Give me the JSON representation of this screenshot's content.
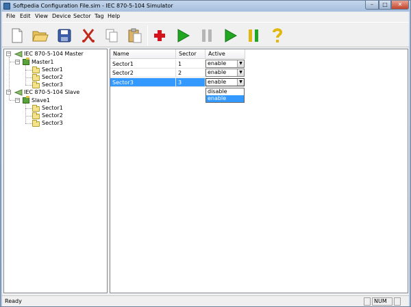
{
  "window": {
    "title": "Softpedia Configuration File.sim - IEC 870-5-104 Simulator"
  },
  "menu": [
    "File",
    "Edit",
    "View",
    "Device",
    "Sector",
    "Tag",
    "Help"
  ],
  "toolbar": {
    "buttons": [
      {
        "icon": "new-file-icon"
      },
      {
        "icon": "open-folder-icon"
      },
      {
        "icon": "save-icon"
      },
      {
        "icon": "cut-icon"
      },
      {
        "icon": "copy-icon"
      },
      {
        "icon": "paste-icon"
      },
      {
        "icon": "add-icon"
      },
      {
        "icon": "play-icon"
      },
      {
        "icon": "pause-icon"
      },
      {
        "icon": "play-all-icon"
      },
      {
        "icon": "step-icon"
      },
      {
        "icon": "help-icon"
      }
    ]
  },
  "tree": {
    "master_root": "IEC 870-5-104 Master",
    "master_device": "Master1",
    "master_sectors": [
      "Sector1",
      "Sector2",
      "Sector3"
    ],
    "slave_root": "IEC 870-5-104 Slave",
    "slave_device": "Slave1",
    "slave_sectors": [
      "Sector1",
      "Sector2",
      "Sector3"
    ]
  },
  "grid": {
    "headers": {
      "name": "Name",
      "sector": "Sector",
      "active": "Active"
    },
    "rows": [
      {
        "name": "Sector1",
        "sector": "1",
        "active": "enable"
      },
      {
        "name": "Sector2",
        "sector": "2",
        "active": "enable"
      },
      {
        "name": "Sector3",
        "sector": "3",
        "active": "enable"
      }
    ],
    "selected_row": 2,
    "dropdown_options": [
      "disable",
      "enable"
    ],
    "dropdown_selected": "enable"
  },
  "status": {
    "text": "Ready",
    "num": "NUM"
  },
  "colors": {
    "selection": "#3399ff",
    "title_gradient_top": "#c3d6ec",
    "close_button": "#c2432b"
  }
}
